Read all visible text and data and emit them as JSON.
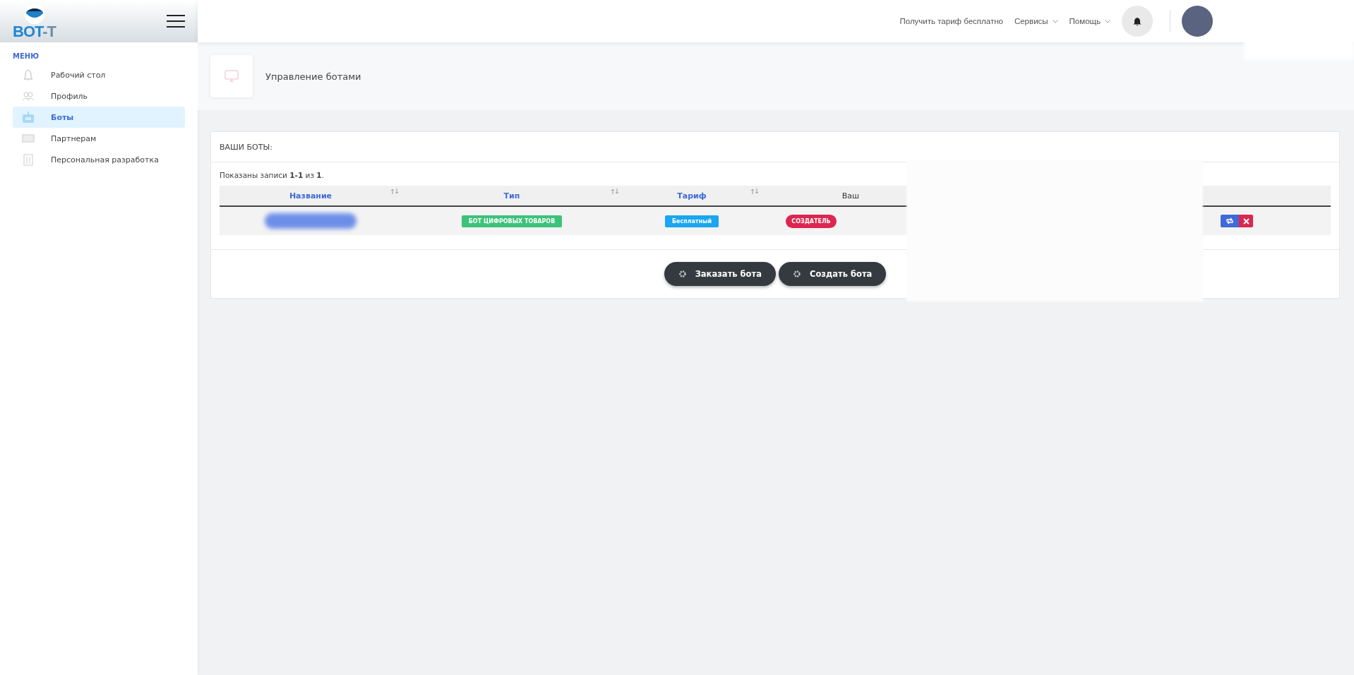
{
  "logo": {
    "main": "BOT",
    "suffix": "-T"
  },
  "sidebar": {
    "heading": "МЕНЮ",
    "items": [
      {
        "label": "Рабочий стол",
        "selected": false
      },
      {
        "label": "Профиль",
        "selected": false
      },
      {
        "label": "Боты",
        "selected": true
      },
      {
        "label": "Партнерам",
        "selected": false
      },
      {
        "label": "Персональная разработка",
        "selected": false
      }
    ]
  },
  "topbar": {
    "links": [
      {
        "label": "Получить тариф бесплатно",
        "dropdown": false
      },
      {
        "label": "Сервисы",
        "dropdown": true
      },
      {
        "label": "Помощь",
        "dropdown": true
      }
    ]
  },
  "page_title": "Управление ботами",
  "card": {
    "title": "ВАШИ БОТЫ:",
    "summary": "Показаны записи **1-1** из **1**.",
    "table": {
      "columns": [
        {
          "label": "Название",
          "sortable": true
        },
        {
          "label": "Тип",
          "sortable": true
        },
        {
          "label": "Тариф",
          "sortable": true
        },
        {
          "label": "Ваш",
          "sortable": false
        }
      ],
      "rows": [
        {
          "cells": [
            {
              "kind": "redacted"
            },
            {
              "kind": "tag",
              "text": "БОТ ЦИФРОВЫХ ТОВАРОВ",
              "color": "#3cc27a"
            },
            {
              "kind": "tag",
              "text": "Бесплатный",
              "color": "#1aa6f0"
            },
            {
              "kind": "pill",
              "text": "СОЗДАТЕЛЬ",
              "color": "#dc2650"
            }
          ]
        }
      ]
    },
    "buttons": [
      {
        "label": "Заказать бота"
      },
      {
        "label": "Создать бота"
      }
    ]
  }
}
